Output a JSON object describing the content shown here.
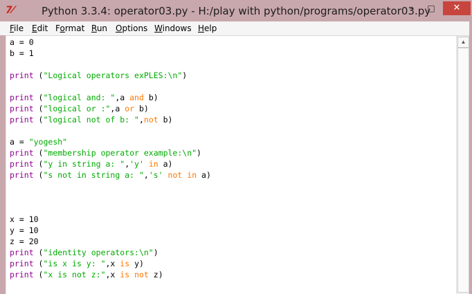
{
  "window": {
    "app_icon": "7⁄",
    "title": "Python 3.3.4: operator03.py - H:/play with python/programs/operator03.py",
    "controls": {
      "minimize": "–",
      "maximize": "□",
      "close": "✕"
    }
  },
  "menu": [
    {
      "key": "F",
      "rest": "ile"
    },
    {
      "key": "E",
      "rest": "dit"
    },
    {
      "key": "",
      "pre": "F",
      "keymid": "o",
      "rest": "rmat"
    },
    {
      "key": "R",
      "rest": "un"
    },
    {
      "key": "O",
      "rest": "ptions"
    },
    {
      "key": "W",
      "rest": "indows"
    },
    {
      "key": "H",
      "rest": "elp"
    }
  ],
  "code_lines": [
    [
      {
        "t": "a = 0",
        "c": ""
      }
    ],
    [
      {
        "t": "b = 1",
        "c": ""
      }
    ],
    [],
    [
      {
        "t": "print",
        "c": "kw-builtin"
      },
      {
        "t": " (",
        "c": ""
      },
      {
        "t": "\"Logical operators exPLES:\\n\"",
        "c": "str"
      },
      {
        "t": ")",
        "c": ""
      }
    ],
    [],
    [
      {
        "t": "print",
        "c": "kw-builtin"
      },
      {
        "t": " (",
        "c": ""
      },
      {
        "t": "\"logical and: \"",
        "c": "str"
      },
      {
        "t": ",a ",
        "c": ""
      },
      {
        "t": "and",
        "c": "kw"
      },
      {
        "t": " b)",
        "c": ""
      }
    ],
    [
      {
        "t": "print",
        "c": "kw-builtin"
      },
      {
        "t": " (",
        "c": ""
      },
      {
        "t": "\"logical or :\"",
        "c": "str"
      },
      {
        "t": ",a ",
        "c": ""
      },
      {
        "t": "or",
        "c": "kw"
      },
      {
        "t": " b)",
        "c": ""
      }
    ],
    [
      {
        "t": "print",
        "c": "kw-builtin"
      },
      {
        "t": " (",
        "c": ""
      },
      {
        "t": "\"logical not of b: \"",
        "c": "str"
      },
      {
        "t": ",",
        "c": ""
      },
      {
        "t": "not",
        "c": "kw"
      },
      {
        "t": " b)",
        "c": ""
      }
    ],
    [],
    [
      {
        "t": "a = ",
        "c": ""
      },
      {
        "t": "\"yogesh\"",
        "c": "str"
      }
    ],
    [
      {
        "t": "print",
        "c": "kw-builtin"
      },
      {
        "t": " (",
        "c": ""
      },
      {
        "t": "\"membership operator example:\\n\"",
        "c": "str"
      },
      {
        "t": ")",
        "c": ""
      }
    ],
    [
      {
        "t": "print",
        "c": "kw-builtin"
      },
      {
        "t": " (",
        "c": ""
      },
      {
        "t": "\"y in string a: \"",
        "c": "str"
      },
      {
        "t": ",",
        "c": ""
      },
      {
        "t": "'y'",
        "c": "str"
      },
      {
        "t": " ",
        "c": ""
      },
      {
        "t": "in",
        "c": "kw"
      },
      {
        "t": " a)",
        "c": ""
      }
    ],
    [
      {
        "t": "print",
        "c": "kw-builtin"
      },
      {
        "t": " (",
        "c": ""
      },
      {
        "t": "\"s not in string a: \"",
        "c": "str"
      },
      {
        "t": ",",
        "c": ""
      },
      {
        "t": "'s'",
        "c": "str"
      },
      {
        "t": " ",
        "c": ""
      },
      {
        "t": "not",
        "c": "kw"
      },
      {
        "t": " ",
        "c": ""
      },
      {
        "t": "in",
        "c": "kw"
      },
      {
        "t": " a)",
        "c": ""
      }
    ],
    [],
    [],
    [],
    [
      {
        "t": "x = 10",
        "c": ""
      }
    ],
    [
      {
        "t": "y = 10",
        "c": ""
      }
    ],
    [
      {
        "t": "z = 20",
        "c": ""
      }
    ],
    [
      {
        "t": "print",
        "c": "kw-builtin"
      },
      {
        "t": " (",
        "c": ""
      },
      {
        "t": "\"identity operators:\\n\"",
        "c": "str"
      },
      {
        "t": ")",
        "c": ""
      }
    ],
    [
      {
        "t": "print",
        "c": "kw-builtin"
      },
      {
        "t": " (",
        "c": ""
      },
      {
        "t": "\"is x is y: \"",
        "c": "str"
      },
      {
        "t": ",x ",
        "c": ""
      },
      {
        "t": "is",
        "c": "kw"
      },
      {
        "t": " y)",
        "c": ""
      }
    ],
    [
      {
        "t": "print",
        "c": "kw-builtin"
      },
      {
        "t": " (",
        "c": ""
      },
      {
        "t": "\"x is not z:\"",
        "c": "str"
      },
      {
        "t": ",x ",
        "c": ""
      },
      {
        "t": "is",
        "c": "kw"
      },
      {
        "t": " ",
        "c": ""
      },
      {
        "t": "not",
        "c": "kw"
      },
      {
        "t": " z)",
        "c": ""
      }
    ]
  ],
  "colors": {
    "titlebar": "#c9a8ad",
    "close_button": "#c7453c",
    "builtin": "#900090",
    "keyword": "#ff7700",
    "string": "#00aa00"
  },
  "scrollbar": {
    "up_arrow": "▲"
  }
}
